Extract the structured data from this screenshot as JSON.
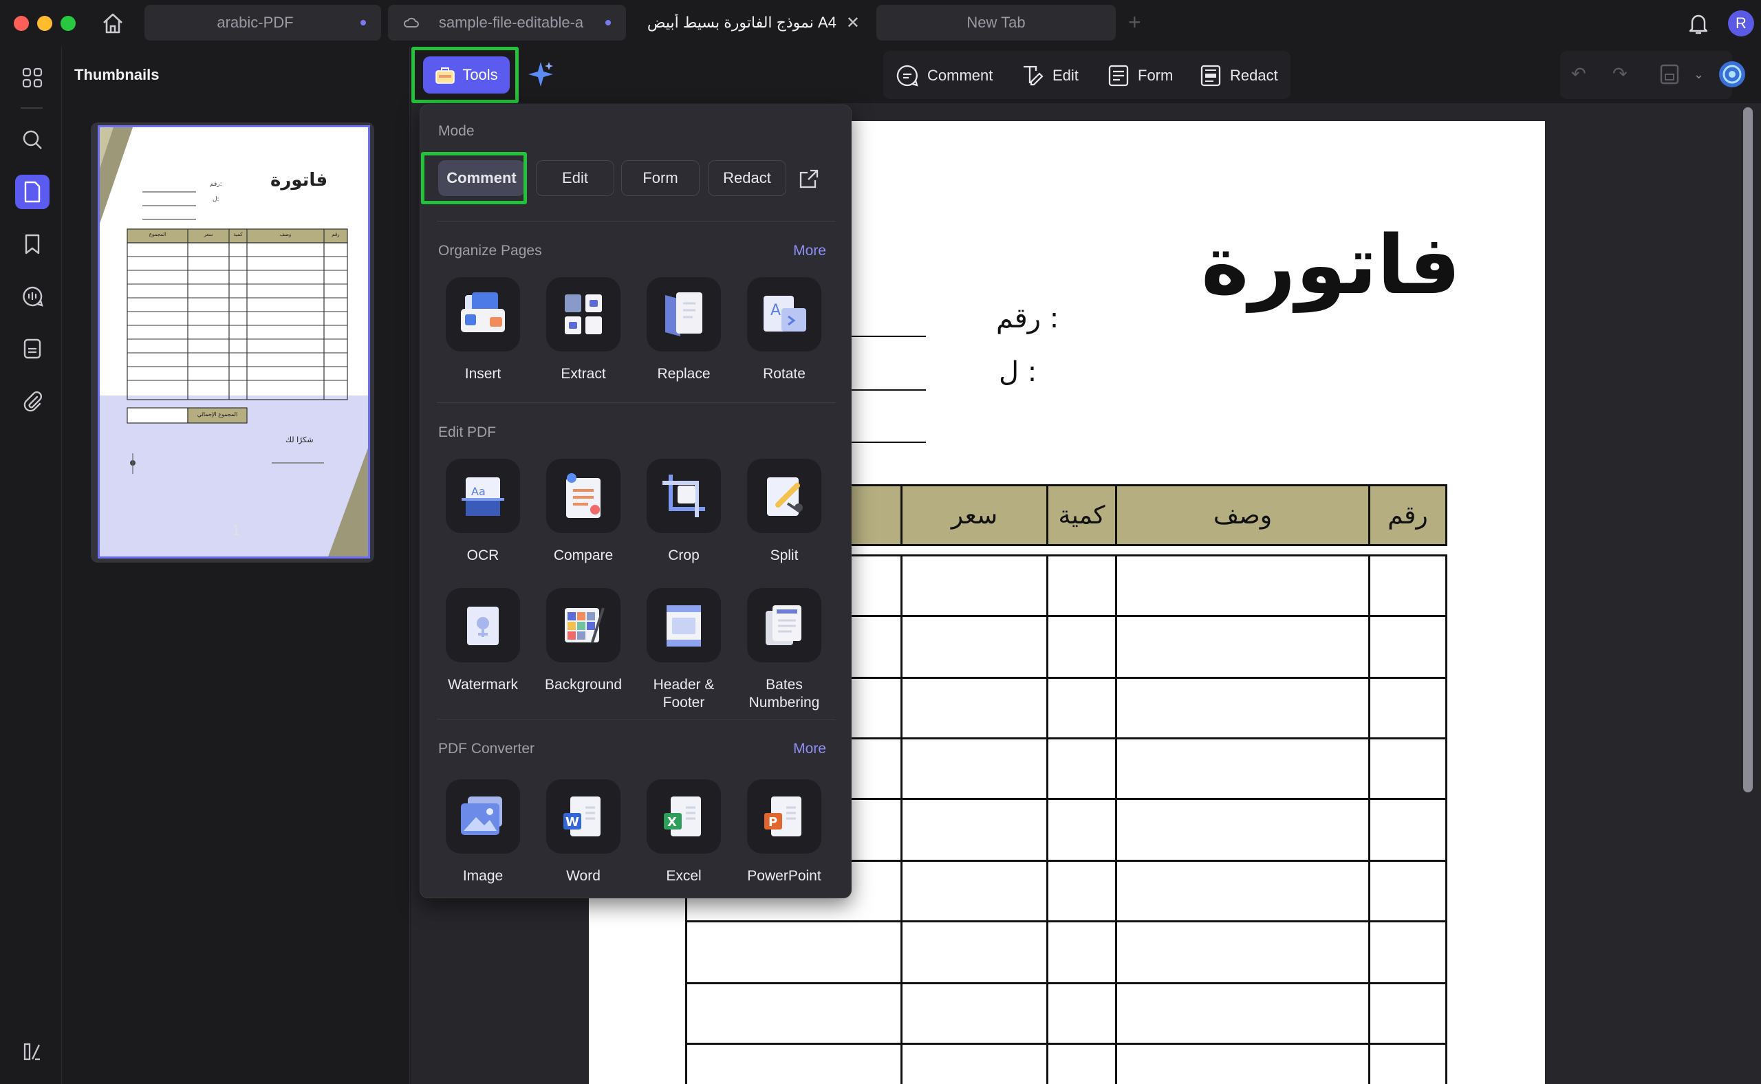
{
  "tabs": [
    {
      "label": "arabic-PDF",
      "dirty": true
    },
    {
      "label": "sample-file-editable-a",
      "dirty": true
    },
    {
      "label": "A4 نموذج الفاتورة بسيط أبيض ر",
      "dirty": false
    },
    {
      "label": "New Tab",
      "dirty": false
    }
  ],
  "user": {
    "initial": "R"
  },
  "thumbnails": {
    "title": "Thumbnails",
    "page_number": "1"
  },
  "toolbar": {
    "tools_label": "Tools",
    "comment_label": "Comment",
    "edit_label": "Edit",
    "form_label": "Form",
    "redact_label": "Redact"
  },
  "menu": {
    "mode_title": "Mode",
    "modes": [
      "Comment",
      "Edit",
      "Form",
      "Redact"
    ],
    "organize_title": "Organize Pages",
    "organize_more": "More",
    "organize_tools": [
      "Insert",
      "Extract",
      "Replace",
      "Rotate"
    ],
    "edit_title": "Edit PDF",
    "edit_tools": [
      "OCR",
      "Compare",
      "Crop",
      "Split"
    ],
    "edit_tools_row2": [
      "Watermark",
      "Background",
      "Header & Footer",
      "Bates Numbering"
    ],
    "converter_title": "PDF Converter",
    "converter_more": "More",
    "converter_tools": [
      "Image",
      "Word",
      "Excel",
      "PowerPoint"
    ]
  },
  "document": {
    "title": "فاتورة",
    "number_label": "رقم :",
    "to_label": "ل :",
    "columns": [
      "رقم",
      "وصف",
      "كمية",
      "سعر"
    ]
  },
  "thumbnail_page": {
    "title": "فاتورة",
    "number_label": "رقم:",
    "to_label": "ل:",
    "columns": [
      "رقم",
      "وصف",
      "كمية",
      "سعر",
      "المجموع"
    ],
    "total_label": "المجموع الإجمالي",
    "thanks": "شكرًا لك"
  },
  "colors": {
    "accent": "#5b5bf0",
    "highlight": "#25c13c",
    "table_header": "#b5ae80"
  }
}
